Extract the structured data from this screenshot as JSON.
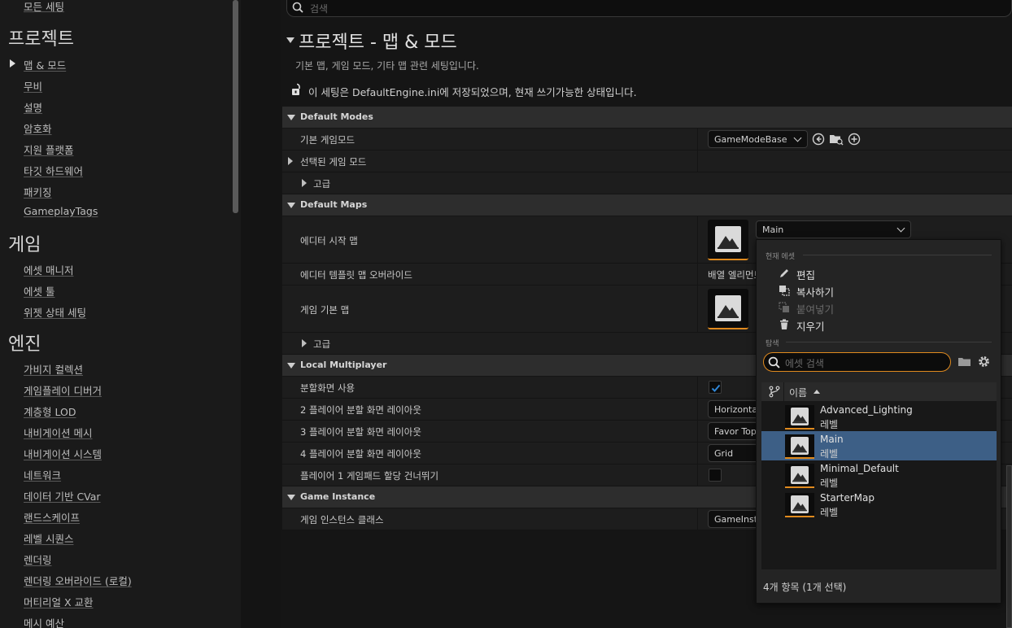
{
  "sidebar": {
    "top_item": "모든 세팅",
    "categories": [
      {
        "title": "프로젝트",
        "items": [
          "맵 & 모드",
          "무비",
          "설명",
          "암호화",
          "지원 플랫폼",
          "타깃 하드웨어",
          "패키징",
          "GameplayTags"
        ]
      },
      {
        "title": "게임",
        "items": [
          "에셋 매니저",
          "에셋 툴",
          "위젯 상태 세팅"
        ]
      },
      {
        "title": "엔진",
        "items": [
          "가비지 컬렉션",
          "게임플레이 디버거",
          "계층형 LOD",
          "내비게이션 메시",
          "내비게이션 시스템",
          "네트워크",
          "데이터 기반 CVar",
          "랜드스케이프",
          "레벨 시퀀스",
          "렌더링",
          "렌더링 오버라이드 (로컬)",
          "머티리얼 X 교환",
          "메시 예산"
        ]
      }
    ]
  },
  "search": {
    "placeholder": "검색"
  },
  "page": {
    "title": "프로젝트 - 맵 & 모드",
    "description": "기본 맵, 게임 모드, 기타 맵 관련 세팅입니다.",
    "config_note": "이 세팅은 DefaultEngine.ini에 저장되었으며, 현재 쓰기가능한 상태입니다."
  },
  "sections": {
    "default_modes": {
      "title": "Default Modes",
      "default_gamemode_label": "기본 게임모드",
      "default_gamemode_value": "GameModeBase",
      "selected_gamemode_label": "선택된 게임 모드",
      "advanced_label": "고급"
    },
    "default_maps": {
      "title": "Default Maps",
      "editor_startup_map_label": "에디터 시작 맵",
      "editor_startup_map_value": "Main",
      "editor_template_label": "에디터 템플릿 맵 오버라이드",
      "editor_template_value": "배열 엘리먼트",
      "game_default_map_label": "게임 기본 맵",
      "advanced_label": "고급"
    },
    "local_multiplayer": {
      "title": "Local Multiplayer",
      "use_splitscreen_label": "분할화면 사용",
      "use_splitscreen_checked": true,
      "two_player_label": "2 플레이어 분할 화면 레이아웃",
      "two_player_value": "Horizontal",
      "three_player_label": "3 플레이어 분할 화면 레이아웃",
      "three_player_value": "Favor Top",
      "four_player_label": "4 플레이어 분할 화면 레이아웃",
      "four_player_value": "Grid",
      "skip_gamepad_label": "플레이어 1 게임패드 할당 건너뛰기",
      "skip_gamepad_checked": false
    },
    "game_instance": {
      "title": "Game Instance",
      "class_label": "게임 인스턴스 클래스",
      "class_value": "GameInsta"
    }
  },
  "popup": {
    "current_asset_header": "현재 에셋",
    "actions": {
      "edit": "편집",
      "copy": "복사하기",
      "paste": "붙여넣기",
      "delete": "지우기"
    },
    "browse_header": "탐색",
    "search_placeholder": "에셋 검색",
    "column_name": "이름",
    "assets": [
      {
        "name": "Advanced_Lighting",
        "type": "레벨",
        "selected": false
      },
      {
        "name": "Main",
        "type": "레벨",
        "selected": true
      },
      {
        "name": "Minimal_Default",
        "type": "레벨",
        "selected": false
      },
      {
        "name": "StarterMap",
        "type": "레벨",
        "selected": false
      }
    ],
    "footer": "4개 항목 (1개 선택)"
  },
  "colors": {
    "accent": "#e08a1e",
    "selection": "#3d5f86",
    "check": "#2f86d6"
  }
}
